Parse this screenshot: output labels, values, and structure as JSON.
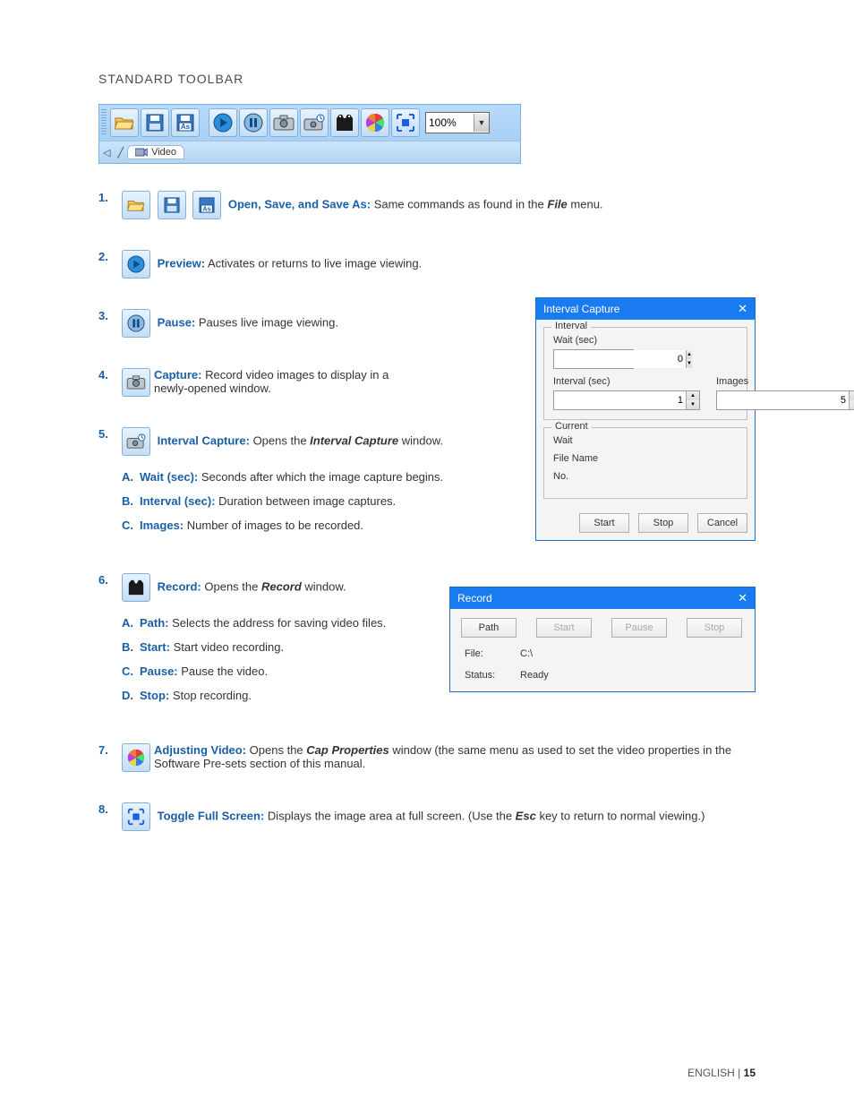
{
  "heading": "STANDARD TOOLBAR",
  "toolbar": {
    "zoom_value": "100%",
    "tab_label": "Video"
  },
  "items": [
    {
      "num": "1.",
      "label": "Open, Save, and Save As:",
      "text_before": " Same commands as found in the ",
      "bold_italic": "File",
      "text_after": " menu."
    },
    {
      "num": "2.",
      "label": "Preview:",
      "text": " Activates or returns to live image viewing."
    },
    {
      "num": "3.",
      "label": "Pause:",
      "text": " Pauses live image viewing."
    },
    {
      "num": "4.",
      "label": "Capture:",
      "text": " Record video images to display in a newly-opened window."
    },
    {
      "num": "5.",
      "label": "Interval Capture:",
      "text_before": " Opens the ",
      "bold_italic": "Interval Capture",
      "text_after": " window.",
      "sub": [
        {
          "l": "A.",
          "label": "Wait (sec):",
          "text": " Seconds after which the image capture begins."
        },
        {
          "l": "B.",
          "label": "Interval (sec):",
          "text": " Duration between image captures."
        },
        {
          "l": "C.",
          "label": "Images:",
          "text": " Number of images to be recorded."
        }
      ]
    },
    {
      "num": "6.",
      "label": "Record:",
      "text_before": " Opens the ",
      "bold_italic": "Record",
      "text_after": " window.",
      "sub": [
        {
          "l": "A.",
          "label": "Path:",
          "text": " Selects the address for saving video files."
        },
        {
          "l": "B.",
          "label": "Start:",
          "text": " Start video recording."
        },
        {
          "l": "C.",
          "label": "Pause:",
          "text": " Pause the video."
        },
        {
          "l": "D.",
          "label": "Stop:",
          "text": " Stop recording."
        }
      ]
    },
    {
      "num": "7.",
      "label": "Adjusting Video:",
      "text_before": " Opens the ",
      "bold_italic": "Cap Properties",
      "text_after": " window (the same menu as used to set the video properties in the Software Pre-sets section of this manual."
    },
    {
      "num": "8.",
      "label": "Toggle Full Screen:",
      "text_before": " Displays the image area at full screen. (Use the ",
      "bold_italic": "Esc",
      "text_after": " key to return to normal viewing.)"
    }
  ],
  "interval_dialog": {
    "title": "Interval Capture",
    "group1_legend": "Interval",
    "wait_label": "Wait (sec)",
    "wait_value": "0",
    "interval_label": "Interval (sec)",
    "interval_value": "1",
    "images_label": "Images",
    "images_value": "5",
    "group2_legend": "Current",
    "cur_wait": "Wait",
    "cur_file": "File Name",
    "cur_no": "No.",
    "btn_start": "Start",
    "btn_stop": "Stop",
    "btn_cancel": "Cancel"
  },
  "record_dialog": {
    "title": "Record",
    "btn_path": "Path",
    "btn_start": "Start",
    "btn_pause": "Pause",
    "btn_stop": "Stop",
    "file_label": "File:",
    "file_value": "C:\\",
    "status_label": "Status:",
    "status_value": "Ready"
  },
  "footer": {
    "lang": "ENGLISH",
    "sep": " | ",
    "page": "15"
  }
}
